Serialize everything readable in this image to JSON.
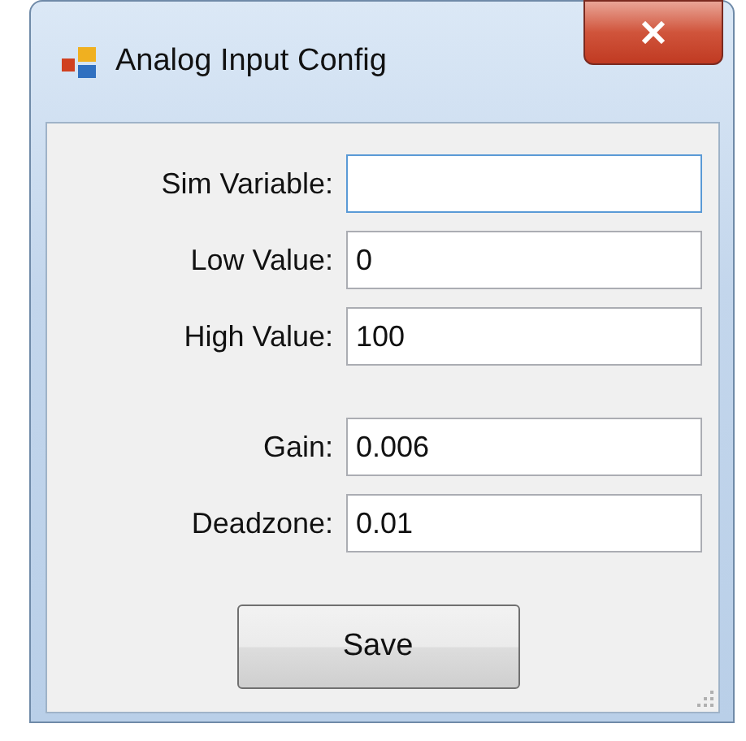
{
  "window": {
    "title": "Analog Input Config"
  },
  "field_groups": [
    [
      {
        "label": "Sim Variable:",
        "focused": true
      },
      {
        "label": "Low Value:",
        "value": "0",
        "focused": false
      },
      {
        "label": "High Value:",
        "value": "100",
        "focused": false
      }
    ],
    [
      {
        "label": "Gain:",
        "value": "0.006",
        "focused": false
      },
      {
        "label": "Deadzone:",
        "value": "0.01",
        "focused": false
      }
    ]
  ],
  "buttons": [
    "Save"
  ]
}
